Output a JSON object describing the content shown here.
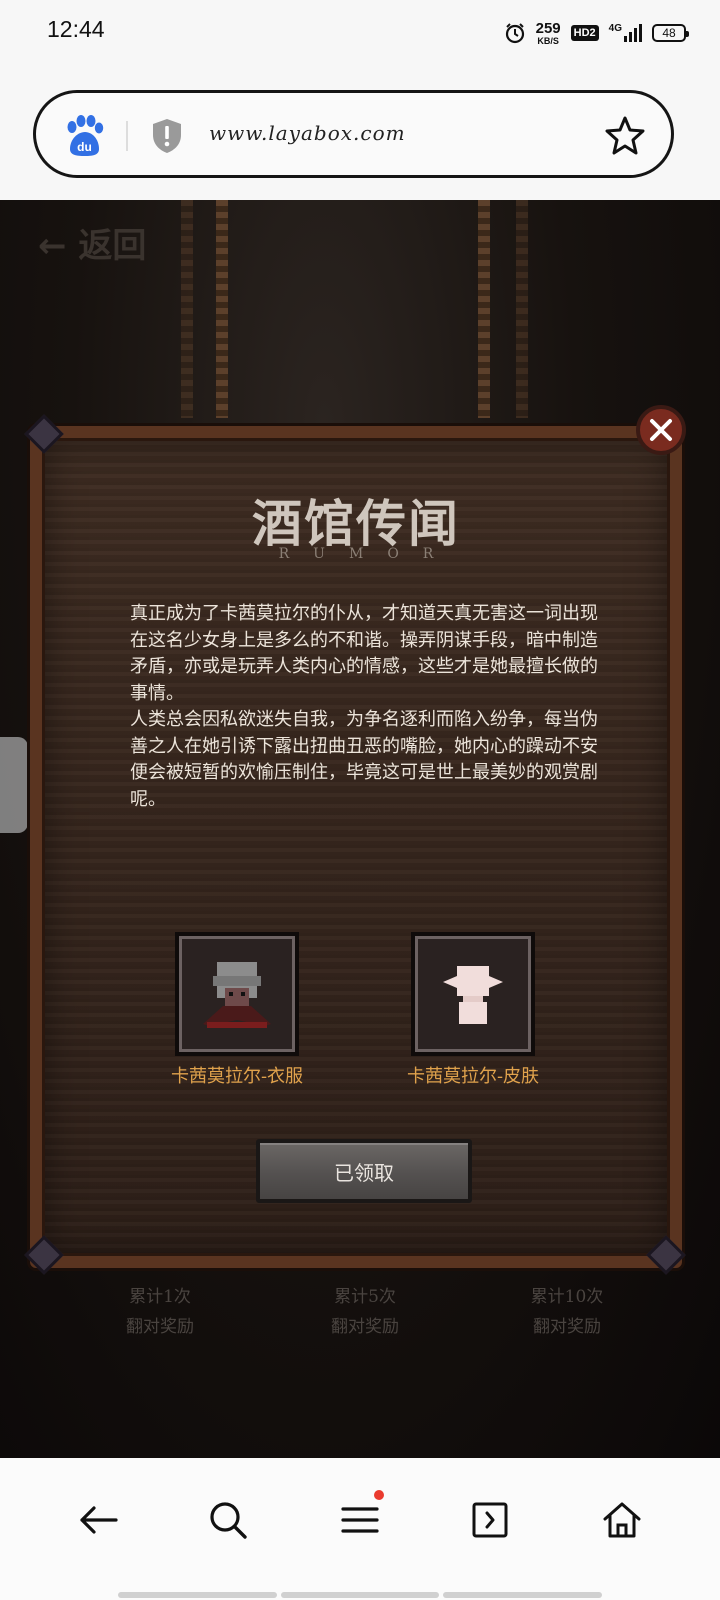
{
  "status_bar": {
    "time": "12:44",
    "net_speed_value": "259",
    "net_speed_unit": "KB/S",
    "hd_badge": "HD2",
    "network": "4G",
    "battery": "48"
  },
  "browser": {
    "url": "www.layabox.com",
    "baidu_logo_text": "du"
  },
  "game": {
    "back_label": "← 返回",
    "panel": {
      "title": "酒馆传闻",
      "subtitle": "RUMOR",
      "story": "真正成为了卡茜莫拉尔的仆从，才知道天真无害这一词出现在这名少女身上是多么的不和谐。操弄阴谋手段，暗中制造矛盾，亦或是玩弄人类内心的情感，这些才是她最擅长做的事情。\n人类总会因私欲迷失自我，为争名逐利而陷入纷争，每当伪善之人在她引诱下露出扭曲丑恶的嘴脸，她内心的躁动不安便会被短暂的欢愉压制住，毕竟这可是世上最美妙的观赏剧呢。",
      "rewards": [
        {
          "label": "卡茜莫拉尔-衣服",
          "icon": "outfit-icon"
        },
        {
          "label": "卡茜莫拉尔-皮肤",
          "icon": "skin-icon"
        }
      ],
      "claim_button": "已领取"
    },
    "milestones": [
      {
        "line1": "累计1次",
        "line2": "翻对奖励"
      },
      {
        "line1": "累计5次",
        "line2": "翻对奖励"
      },
      {
        "line1": "累计10次",
        "line2": "翻对奖励"
      }
    ]
  },
  "colors": {
    "reward_label": "#e0a24c",
    "panel_wood": "#3e2c22",
    "close_button": "#7a2b1f"
  }
}
